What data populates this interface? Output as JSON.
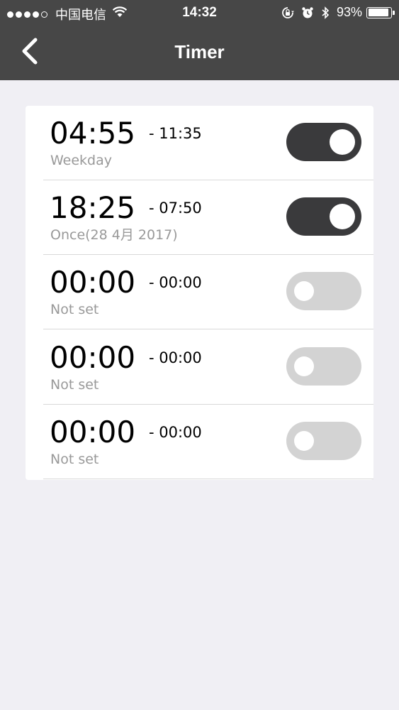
{
  "status_bar": {
    "carrier": "中国电信",
    "time": "14:32",
    "battery_percent": "93%",
    "battery_level": 0.93,
    "signal_bars_filled": 4,
    "signal_bars_total": 5,
    "icons": [
      "wifi-icon",
      "rotation-lock-icon",
      "alarm-icon",
      "bluetooth-icon",
      "battery-icon"
    ]
  },
  "nav": {
    "back_icon": "chevron-left-icon",
    "title": "Timer"
  },
  "colors": {
    "header_bg": "#474747",
    "page_bg": "#f0eff4",
    "toggle_on": "#3a3a3c",
    "toggle_off": "#d3d3d3",
    "secondary_text": "#999999"
  },
  "timers": [
    {
      "start": "04:55",
      "end": "- 11:35",
      "repeat": "Weekday",
      "enabled": true
    },
    {
      "start": "18:25",
      "end": "- 07:50",
      "repeat": "Once(28 4月 2017)",
      "enabled": true
    },
    {
      "start": "00:00",
      "end": "- 00:00",
      "repeat": "Not set",
      "enabled": false
    },
    {
      "start": "00:00",
      "end": "- 00:00",
      "repeat": "Not set",
      "enabled": false
    },
    {
      "start": "00:00",
      "end": "- 00:00",
      "repeat": "Not set",
      "enabled": false
    }
  ]
}
